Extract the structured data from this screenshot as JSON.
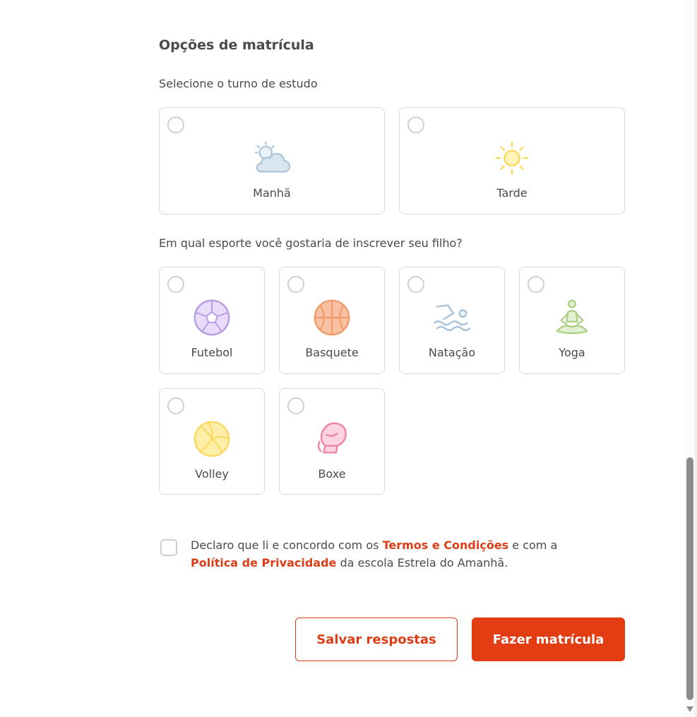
{
  "section": {
    "title": "Opções de matrícula",
    "shift_question": "Selecione o turno de estudo",
    "sport_question": "Em qual esporte você gostaria de inscrever seu filho?"
  },
  "shifts": [
    {
      "label": "Manhã",
      "icon": "cloud-sun-icon",
      "color": "#a9c4d9"
    },
    {
      "label": "Tarde",
      "icon": "sun-icon",
      "color": "#f9d863"
    }
  ],
  "sports": [
    {
      "label": "Futebol",
      "icon": "soccer-ball-icon",
      "color": "#b79be6"
    },
    {
      "label": "Basquete",
      "icon": "basketball-icon",
      "color": "#f29a6c"
    },
    {
      "label": "Natação",
      "icon": "swimmer-icon",
      "color": "#a9c4d9"
    },
    {
      "label": "Yoga",
      "icon": "yoga-icon",
      "color": "#a9cf7f"
    },
    {
      "label": "Volley",
      "icon": "volleyball-icon",
      "color": "#f9d863"
    },
    {
      "label": "Boxe",
      "icon": "boxing-glove-icon",
      "color": "#ee84a8"
    }
  ],
  "terms": {
    "prefix": "Declaro que li e concordo com os ",
    "terms_link": "Termos e Condições",
    "middle": " e com a ",
    "privacy_link": "Política de Privacidade",
    "suffix": " da escola Estrela do Amanhã."
  },
  "buttons": {
    "save_label": "Salvar respostas",
    "submit_label": "Fazer matrícula"
  },
  "colors": {
    "accent": "#e13c12",
    "link": "#dc3c16"
  }
}
